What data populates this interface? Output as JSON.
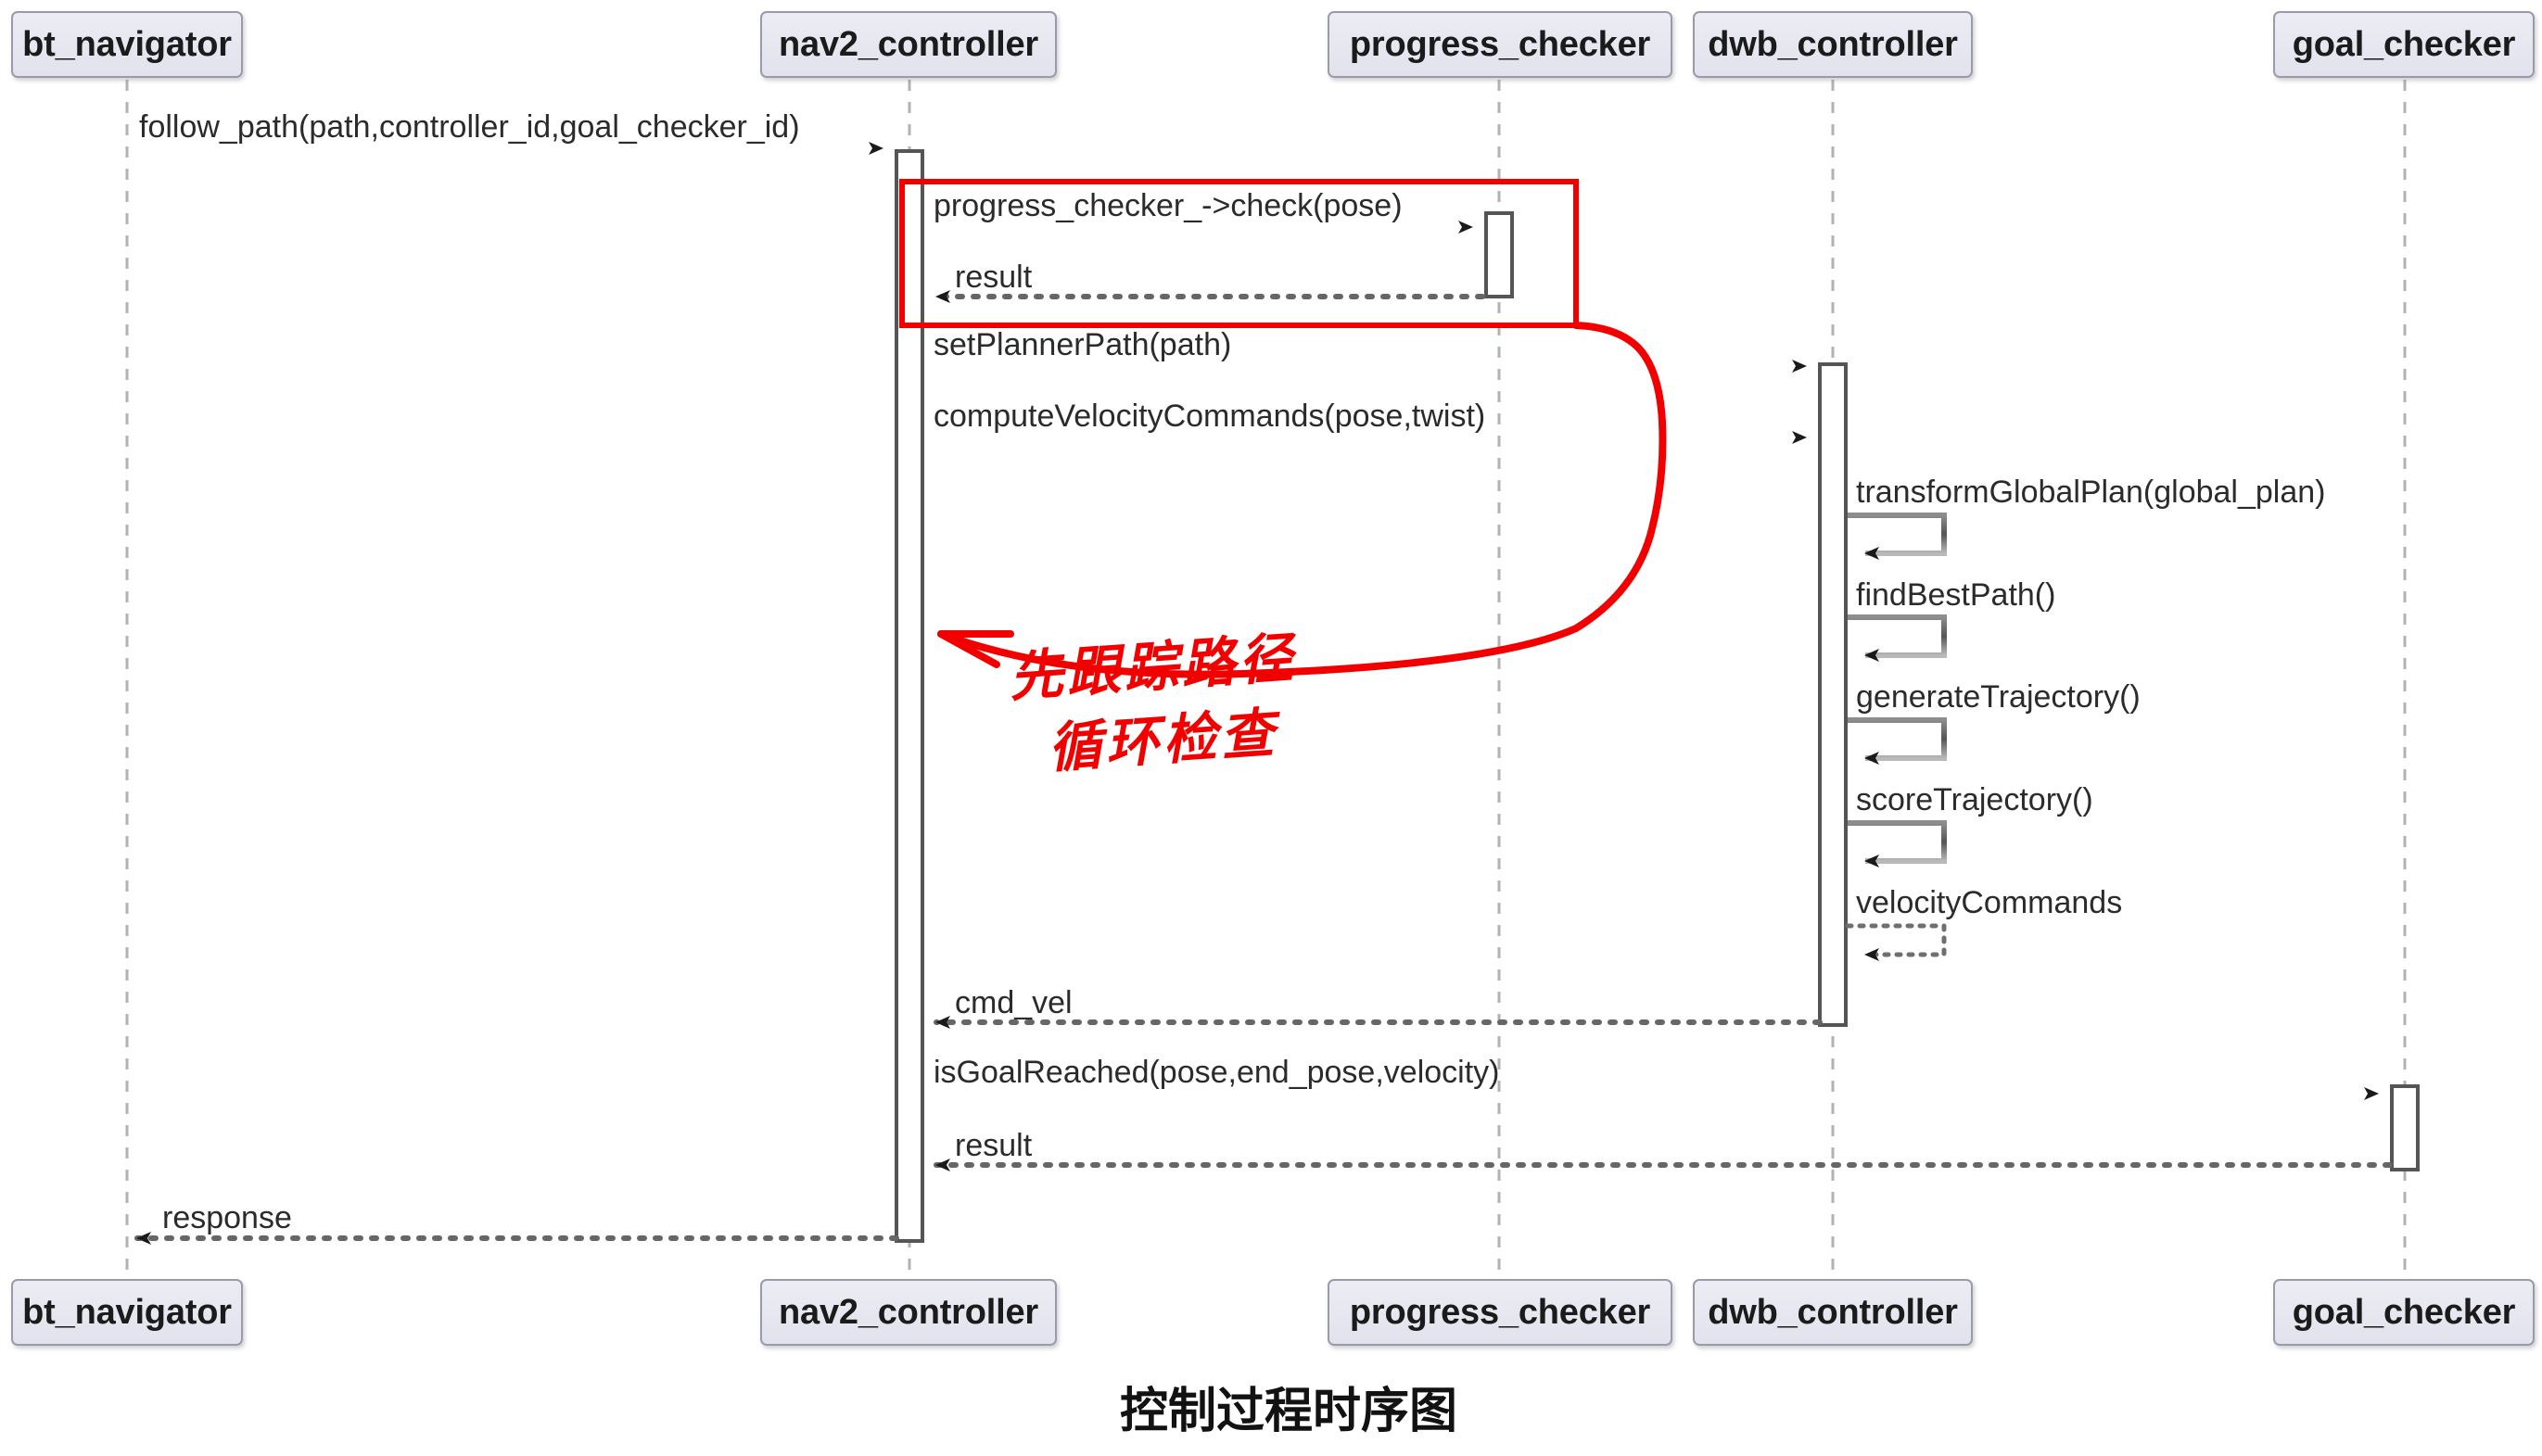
{
  "diagram": {
    "title": "控制过程时序图",
    "type": "uml-sequence-diagram",
    "colors": {
      "participant_fill": "#e2e2ee",
      "participant_border": "#9a9aa8",
      "lifeline": "#b0b0b0",
      "message_line": "#707070",
      "annotation_red": "#f20000",
      "text": "#2b2b2b",
      "background": "#ffffff"
    },
    "participants": [
      {
        "name": "bt_navigator",
        "label": "bt_navigator"
      },
      {
        "name": "nav2_controller",
        "label": "nav2_controller"
      },
      {
        "name": "progress_checker",
        "label": "progress_checker"
      },
      {
        "name": "dwb_controller",
        "label": "dwb_controller"
      },
      {
        "name": "goal_checker",
        "label": "goal_checker"
      }
    ],
    "messages": [
      {
        "id": "m1",
        "label": "follow_path(path,controller_id,goal_checker_id)",
        "from": "bt_navigator",
        "to": "nav2_controller",
        "style": "solid",
        "direction": "right"
      },
      {
        "id": "m2",
        "label": "progress_checker_->check(pose)",
        "from": "nav2_controller",
        "to": "progress_checker",
        "style": "solid",
        "direction": "right"
      },
      {
        "id": "m3",
        "label": "result",
        "from": "progress_checker",
        "to": "nav2_controller",
        "style": "dotted",
        "direction": "left"
      },
      {
        "id": "m4",
        "label": "setPlannerPath(path)",
        "from": "nav2_controller",
        "to": "dwb_controller",
        "style": "solid",
        "direction": "right"
      },
      {
        "id": "m5",
        "label": "computeVelocityCommands(pose,twist)",
        "from": "nav2_controller",
        "to": "dwb_controller",
        "style": "solid",
        "direction": "right"
      },
      {
        "id": "m6",
        "label": "transformGlobalPlan(global_plan)",
        "from": "dwb_controller",
        "to": "dwb_controller",
        "style": "solid",
        "direction": "self"
      },
      {
        "id": "m7",
        "label": "findBestPath()",
        "from": "dwb_controller",
        "to": "dwb_controller",
        "style": "solid",
        "direction": "self"
      },
      {
        "id": "m8",
        "label": "generateTrajectory()",
        "from": "dwb_controller",
        "to": "dwb_controller",
        "style": "solid",
        "direction": "self"
      },
      {
        "id": "m9",
        "label": "scoreTrajectory()",
        "from": "dwb_controller",
        "to": "dwb_controller",
        "style": "solid",
        "direction": "self"
      },
      {
        "id": "m10",
        "label": "velocityCommands",
        "from": "dwb_controller",
        "to": "dwb_controller",
        "style": "dotted",
        "direction": "self"
      },
      {
        "id": "m11",
        "label": "cmd_vel",
        "from": "dwb_controller",
        "to": "nav2_controller",
        "style": "dotted",
        "direction": "left"
      },
      {
        "id": "m12",
        "label": "isGoalReached(pose,end_pose,velocity)",
        "from": "nav2_controller",
        "to": "goal_checker",
        "style": "solid",
        "direction": "right"
      },
      {
        "id": "m13",
        "label": "result",
        "from": "goal_checker",
        "to": "nav2_controller",
        "style": "dotted",
        "direction": "left"
      },
      {
        "id": "m14",
        "label": "response",
        "from": "nav2_controller",
        "to": "bt_navigator",
        "style": "dotted",
        "direction": "left"
      }
    ],
    "annotations": {
      "highlight_box": {
        "name": "progress-check-highlight",
        "color": "#f20000",
        "covers": [
          "progress_checker_->check(pose)",
          "result"
        ]
      },
      "handwriting": {
        "line1": "先跟踪路径",
        "line2": "循环检查",
        "color": "#f20000",
        "arrow": "curved-pointer"
      }
    }
  }
}
